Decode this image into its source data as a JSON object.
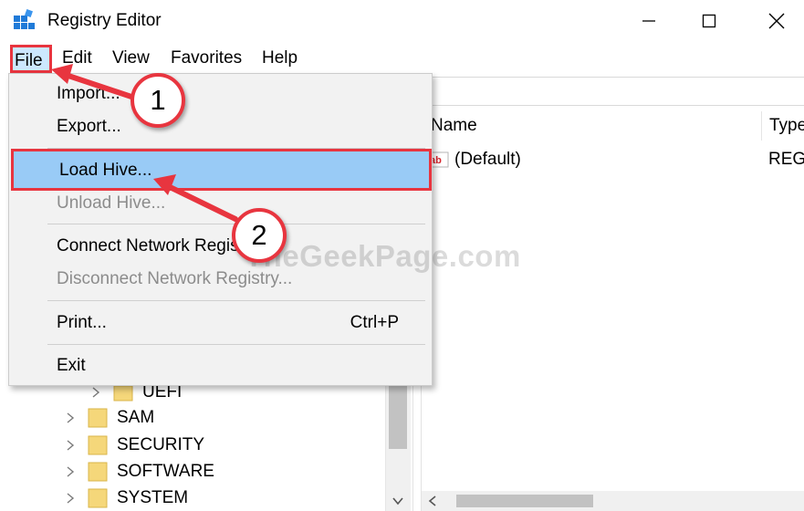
{
  "window": {
    "title": "Registry Editor",
    "minimize_glyph": "—",
    "maximize_glyph": "☐",
    "close_glyph": "✕"
  },
  "menubar": {
    "items": [
      {
        "label": "File"
      },
      {
        "label": "Edit"
      },
      {
        "label": "View"
      },
      {
        "label": "Favorites"
      },
      {
        "label": "Help"
      }
    ]
  },
  "file_menu": {
    "items": [
      {
        "label": "Import...",
        "enabled": true
      },
      {
        "label": "Export...",
        "enabled": true
      },
      {
        "label": "Load Hive...",
        "enabled": true,
        "highlighted": true
      },
      {
        "label": "Unload Hive...",
        "enabled": false
      },
      {
        "label": "Connect Network Registry...",
        "enabled": true
      },
      {
        "label": "Disconnect Network Registry...",
        "enabled": false
      },
      {
        "label": "Print...",
        "shortcut": "Ctrl+P",
        "enabled": true
      },
      {
        "label": "Exit",
        "enabled": true
      }
    ]
  },
  "tree": {
    "items": [
      {
        "label": "UEFI"
      },
      {
        "label": "SAM"
      },
      {
        "label": "SECURITY"
      },
      {
        "label": "SOFTWARE"
      },
      {
        "label": "SYSTEM"
      }
    ]
  },
  "list": {
    "columns": {
      "name": "Name",
      "type": "Type"
    },
    "rows": [
      {
        "name": "(Default)",
        "type": "REG_"
      }
    ]
  },
  "annotations": {
    "callout_1": "1",
    "callout_2": "2",
    "watermark": "TheGeekPage.com"
  },
  "colors": {
    "highlight_border": "#e8353f",
    "menu_selection": "#99cbf6",
    "folder": "#f5d77a",
    "app_icon_blue": "#1f7ad8"
  }
}
